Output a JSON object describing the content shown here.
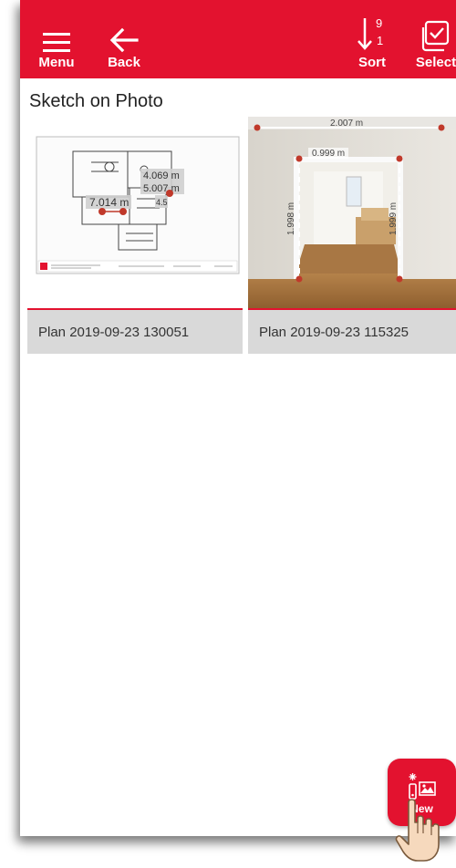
{
  "toolbar": {
    "menu_label": "Menu",
    "back_label": "Back",
    "sort_label": "Sort",
    "sort_top": "9",
    "sort_bottom": "1",
    "select_label": "Select"
  },
  "section_title": "Sketch on Photo",
  "items": [
    {
      "name": "Plan 2019-09-23 130051",
      "labels": [
        "4.069 m",
        "5.007 m",
        "7.014 m",
        "4.5"
      ]
    },
    {
      "name": "Plan 2019-09-23 115325",
      "labels": [
        "2.007 m",
        "0.999 m",
        "1.998 m",
        "1.999 m"
      ]
    }
  ],
  "fab": {
    "label": "New"
  },
  "colors": {
    "accent": "#e3122f",
    "caption_bg": "#d9d9d9"
  }
}
